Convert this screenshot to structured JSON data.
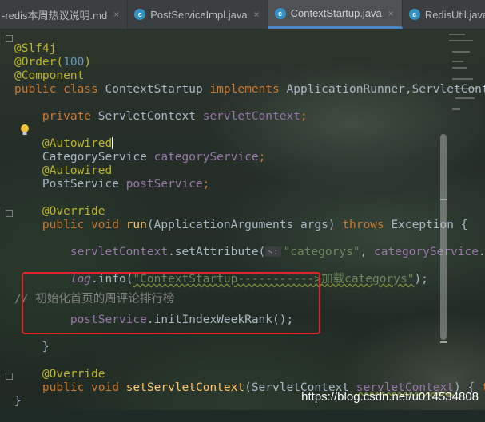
{
  "tabs": [
    {
      "label": "-redis本周热议说明.md",
      "icon": "markdown-icon",
      "active": false
    },
    {
      "label": "PostServiceImpl.java",
      "icon": "class-icon",
      "active": false
    },
    {
      "label": "ContextStartup.java",
      "icon": "class-icon",
      "active": true
    },
    {
      "label": "RedisUtil.java",
      "icon": "class-icon",
      "active": false
    }
  ],
  "tab_icon_letter": "c",
  "close_glyph": "×",
  "code": {
    "l0": "@Slf4j",
    "l1_ann": "@Order(",
    "l1_num": "100",
    "l1_end": ")",
    "l2": "@Component",
    "l3_kw1": "public class ",
    "l3_name": "ContextStartup ",
    "l3_kw2": "implements ",
    "l3_rest": "ApplicationRunner,ServletCont",
    "l5_kw": "private ",
    "l5_type": "ServletContext ",
    "l5_field": "servletContext",
    "l5_end": ";",
    "l7": "@Autowired",
    "l8_type": "CategoryService ",
    "l8_field": "categoryService",
    "l8_end": ";",
    "l9": "@Autowired",
    "l10_type": "PostService ",
    "l10_field": "postService",
    "l10_end": ";",
    "l12": "@Override",
    "l13_kw": "public void ",
    "l13_fn": "run",
    "l13_mid": "(ApplicationArguments args) ",
    "l13_kw2": "throws ",
    "l13_end": "Exception {",
    "l15_field": "servletContext",
    "l15_call": ".setAttribute(",
    "l15_hint": "s:",
    "l15_str": "\"categorys\"",
    "l15_rest": ", ",
    "l15_field2": "categoryService",
    "l15_end": ".",
    "l17_log": "log",
    "l17_call": ".info(",
    "l17_str": "\"ContextStartup----------->加载categorys\"",
    "l17_end": ");",
    "l19_comment": "//       初始化首页的周评论排行榜",
    "l20_field": "postService",
    "l20_call": ".initIndexWeekRank();",
    "l22": "}",
    "l24": "@Override",
    "l25_kw": "public void ",
    "l25_fn": "setServletContext",
    "l25_mid": "(ServletContext ",
    "l25_param": "servletContext",
    "l25_end": ") { ",
    "l25_t": "t",
    "l26": "}"
  },
  "watermark": "https://blog.csdn.net/u014534808",
  "colors": {
    "annotation": "#bbb529",
    "keyword": "#cc7832",
    "field": "#9876aa",
    "string": "#6a8759",
    "highlight_box": "#e0252a"
  }
}
